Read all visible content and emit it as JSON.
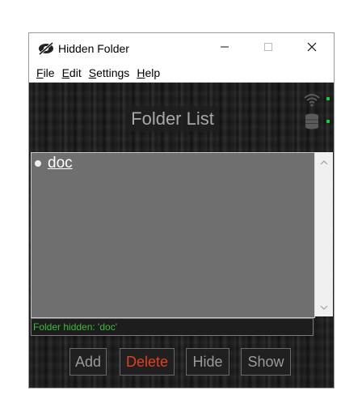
{
  "window": {
    "title": "Hidden Folder",
    "icon": "eye-slash-icon"
  },
  "window_controls": {
    "minimize": "minimize-icon",
    "maximize": "maximize-icon",
    "close": "close-icon"
  },
  "menu": {
    "items": [
      {
        "underline": "F",
        "rest": "ile"
      },
      {
        "underline": "E",
        "rest": "dit"
      },
      {
        "underline": "S",
        "rest": "ettings"
      },
      {
        "underline": "H",
        "rest": "elp"
      }
    ]
  },
  "header": {
    "title": "Folder List",
    "icons": [
      "wifi-icon",
      "database-icon"
    ],
    "indicator_color": "#1fcf3a"
  },
  "list": {
    "items": [
      {
        "label": "doc"
      }
    ]
  },
  "status": {
    "text": "Folder hidden: 'doc'",
    "color": "#3dbb3d"
  },
  "buttons": {
    "add": "Add",
    "delete": "Delete",
    "hide": "Hide",
    "show": "Show",
    "delete_color": "#e2401f"
  }
}
